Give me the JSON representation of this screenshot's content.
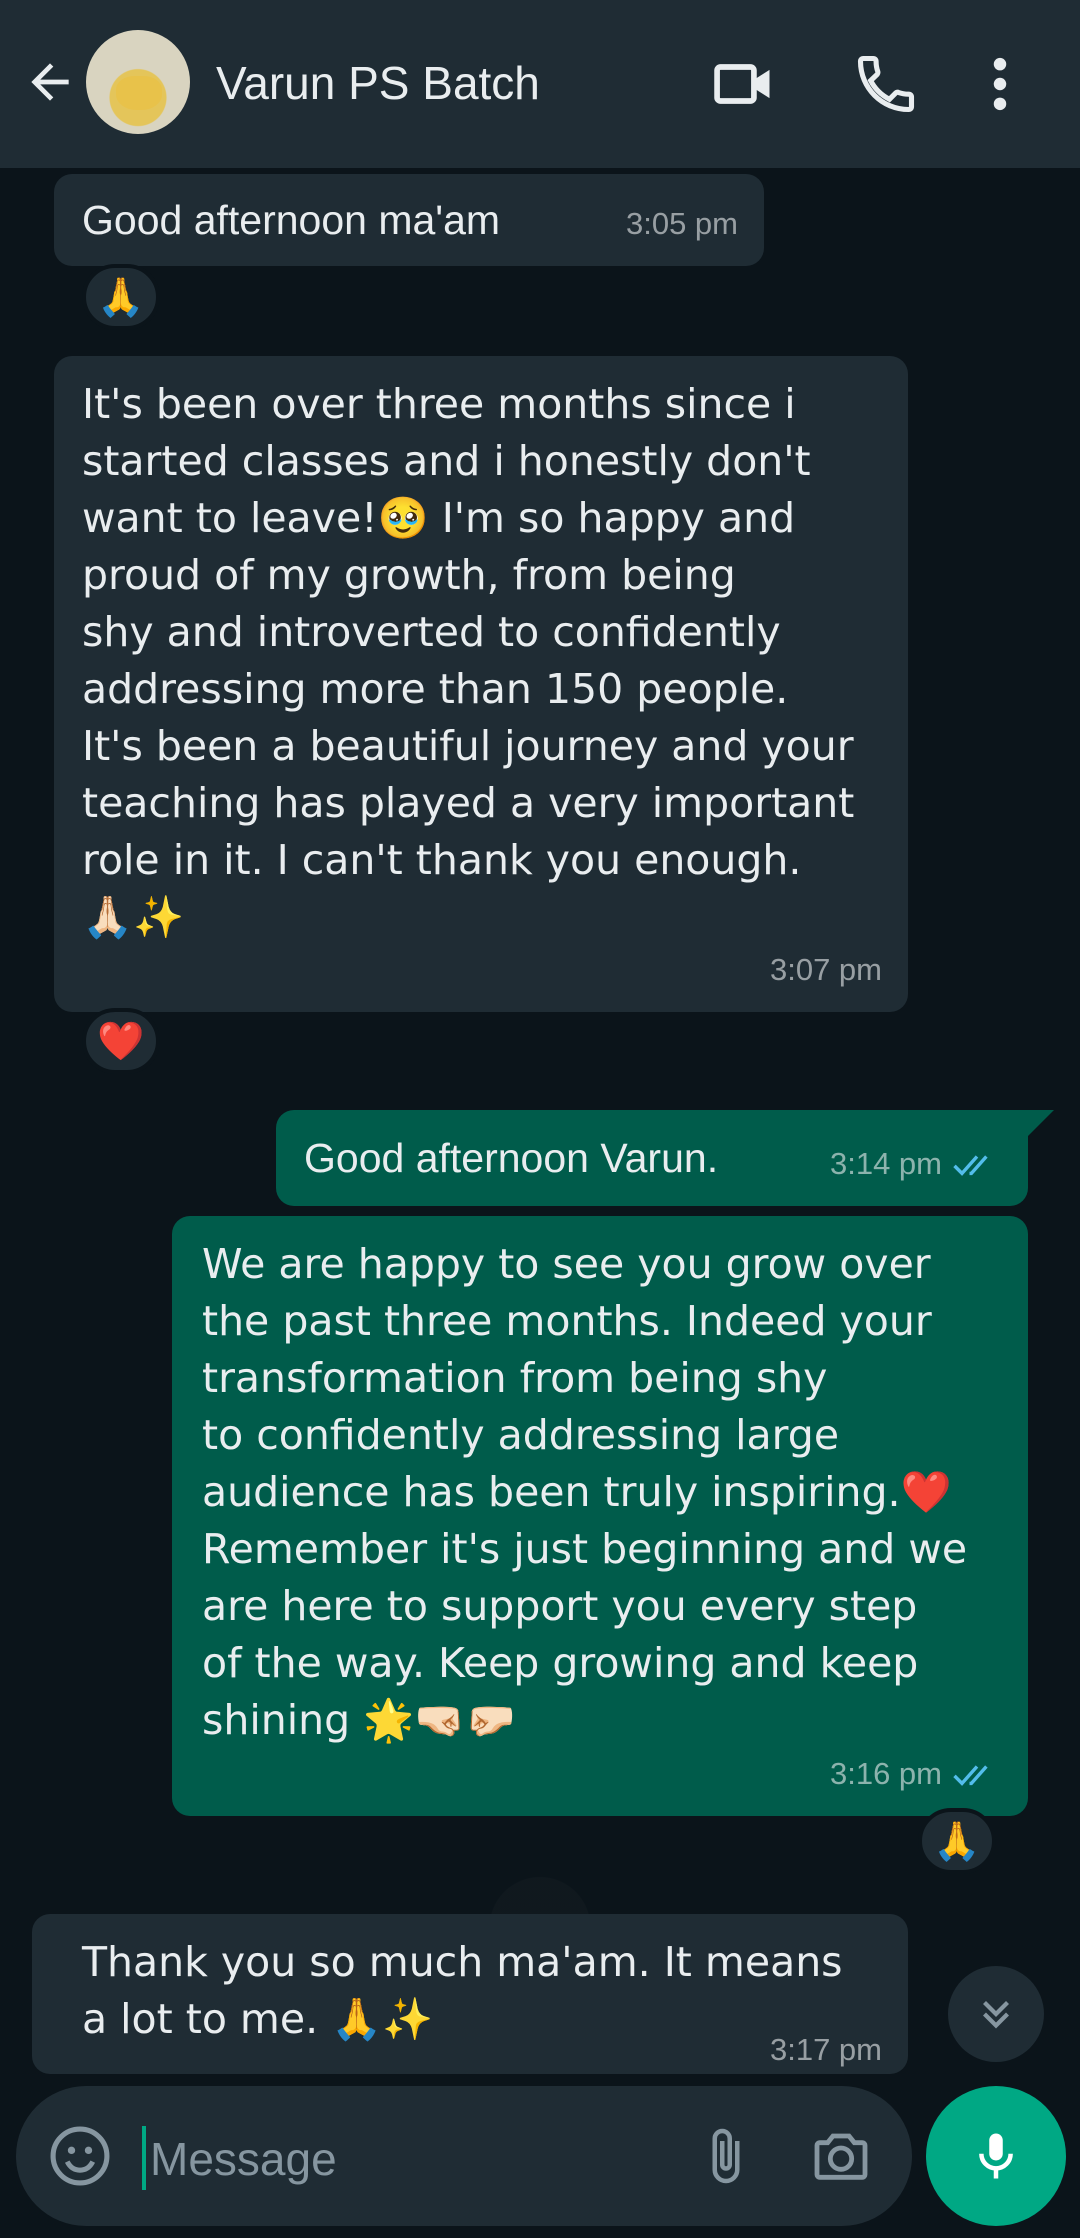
{
  "header": {
    "title": "Varun PS Batch",
    "icons": [
      "back-arrow-icon",
      "avatar",
      "video-call-icon",
      "voice-call-icon",
      "more-options-icon"
    ]
  },
  "messages": [
    {
      "direction": "in",
      "text": "Good afternoon ma'am",
      "time": "3:05 pm",
      "reaction": "🙏"
    },
    {
      "direction": "in",
      "text": "It's been over three months since i\nstarted classes and i honestly don't\nwant to leave!🥹 I'm so happy and\nproud of my growth, from being\nshy and introverted to confidently\naddressing more than 150 people.\nIt's been a beautiful journey and your\nteaching has played a very important\nrole in it. I can't thank you enough.\n🙏🏻✨",
      "time": "3:07 pm",
      "reaction": "❤️"
    },
    {
      "direction": "out",
      "text": "Good afternoon Varun.",
      "time": "3:14 pm",
      "status": "read"
    },
    {
      "direction": "out",
      "text": "We are happy to see you grow over\nthe past three months. Indeed your\ntransformation from being shy\nto confidently addressing large\naudience has been truly inspiring.❤️\nRemember it's just beginning and we\nare here to support you every step\nof the way. Keep growing and keep\nshining 🌟🤜🏻🤛🏻",
      "time": "3:16 pm",
      "status": "read",
      "reaction": "🙏"
    },
    {
      "direction": "in",
      "text": "Thank you so much ma'am. It means\na lot to me. 🙏✨",
      "time": "3:17 pm"
    }
  ],
  "composer": {
    "placeholder": "Message"
  },
  "colors": {
    "background": "#0b141a",
    "header": "#1f2c34",
    "incoming_bubble": "#1f2c34",
    "outgoing_bubble": "#005c4b",
    "accent": "#00a884",
    "read_ticks": "#53bdeb"
  }
}
